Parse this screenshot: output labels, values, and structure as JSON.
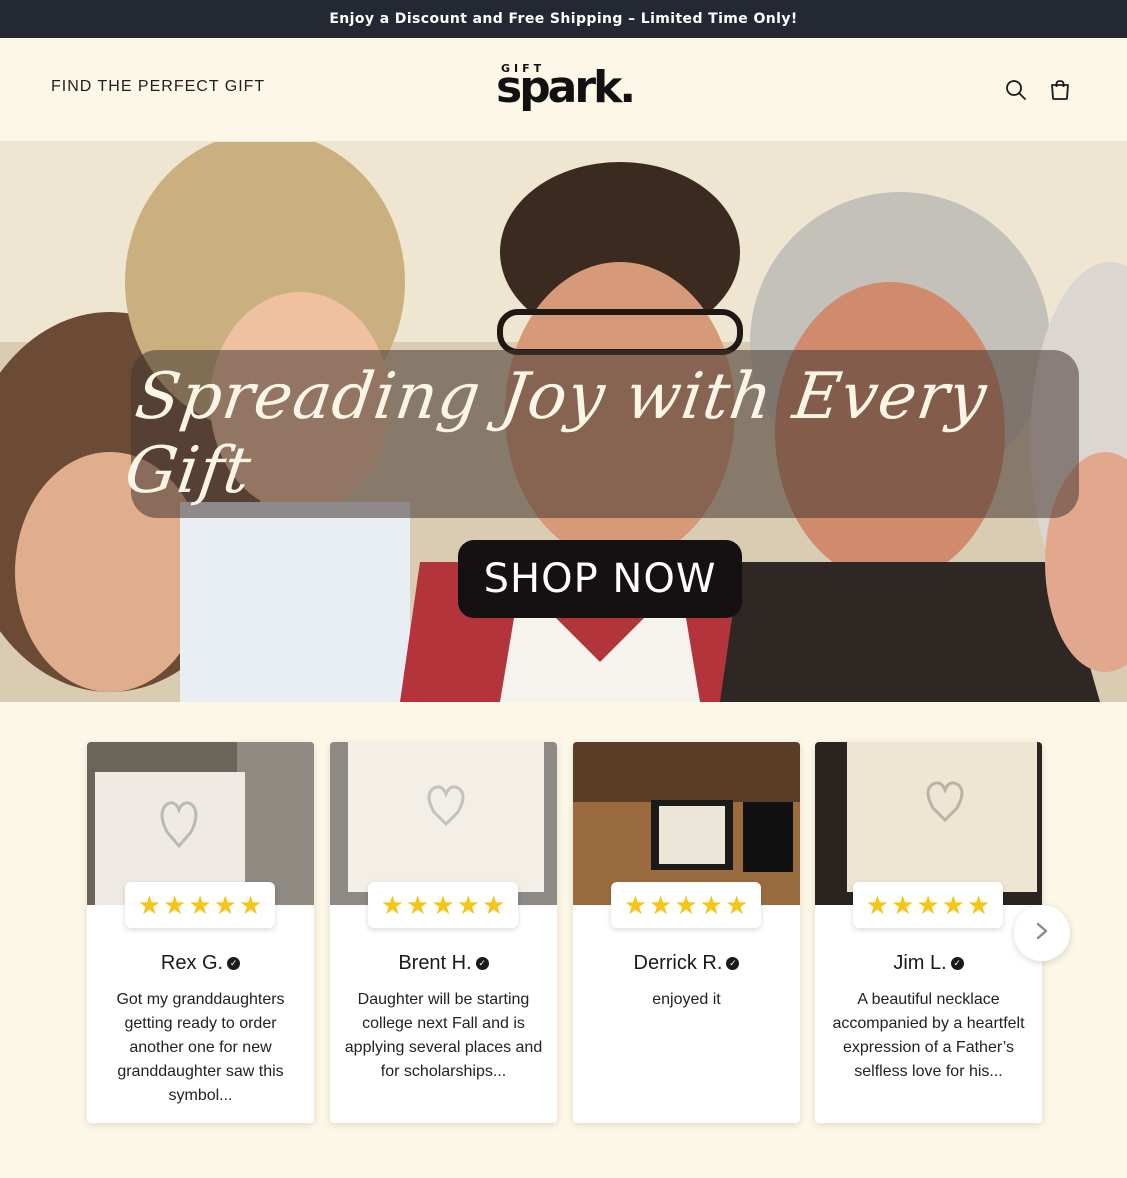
{
  "announcement": "Enjoy a Discount and Free Shipping – Limited Time Only!",
  "header": {
    "nav_link": "FIND THE PERFECT GIFT",
    "logo_small": "GIFT",
    "logo_big": "spark.",
    "icons": [
      "search-icon",
      "cart-icon"
    ]
  },
  "hero": {
    "headline": "Spreading Joy with Every Gift",
    "cta": "SHOP NOW"
  },
  "reviews": [
    {
      "name": "Rex G.",
      "rating": 5,
      "text": "Got my granddaughters getting ready to order another one for new granddaughter saw this symbol..."
    },
    {
      "name": "Brent H.",
      "rating": 5,
      "text": "Daughter will be starting college next Fall and is applying several places and for scholarships..."
    },
    {
      "name": "Derrick R.",
      "rating": 5,
      "text": "enjoyed it"
    },
    {
      "name": "Jim L.",
      "rating": 5,
      "text": "A beautiful necklace accompanied by a heartfelt expression of a Father’s selfless love for his..."
    }
  ],
  "colors": {
    "announcement_bg": "#242833",
    "page_bg": "#fdf7e7",
    "star": "#f5c518",
    "cta_bg": "#151113"
  }
}
